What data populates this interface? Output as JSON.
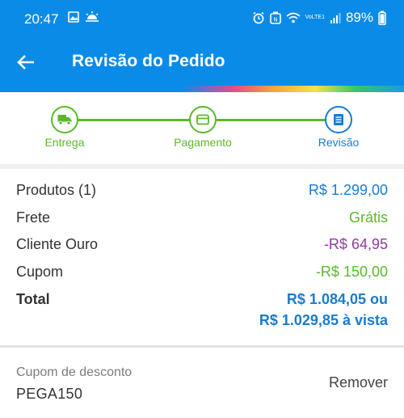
{
  "status_bar": {
    "time": "20:47",
    "battery": "89%",
    "network_label": "VoLTE1",
    "icons": [
      "image-icon",
      "weather-icon",
      "alarm-icon",
      "nfc-icon",
      "wifi-icon",
      "signal-icon",
      "battery-icon"
    ]
  },
  "app_bar": {
    "title": "Revisão do Pedido",
    "back_icon": "arrow-left-icon"
  },
  "colors": {
    "primary": "#0a8be8",
    "step_done": "#5bb82a",
    "step_current": "#1a7bd0",
    "price_blue": "#1a7bd0",
    "green": "#5bb82a",
    "purple": "#8e3c9e"
  },
  "stepper": {
    "steps": [
      {
        "label": "Entrega",
        "icon": "truck-icon",
        "state": "done"
      },
      {
        "label": "Pagamento",
        "icon": "credit-card-icon",
        "state": "done"
      },
      {
        "label": "Revisão",
        "icon": "document-icon",
        "state": "current"
      }
    ]
  },
  "summary": {
    "products_label": "Produtos (1)",
    "products_value": "R$ 1.299,00",
    "shipping_label": "Frete",
    "shipping_value": "Grátis",
    "gold_label": "Cliente Ouro",
    "gold_value": "-R$ 64,95",
    "coupon_label": "Cupom",
    "coupon_value": "-R$ 150,00",
    "total_label": "Total",
    "total_value_line1": "R$ 1.084,05 ou",
    "total_value_line2": "R$ 1.029,85 à vista"
  },
  "coupon": {
    "caption": "Cupom de desconto",
    "code": "PEGA150",
    "remove_label": "Remover"
  }
}
